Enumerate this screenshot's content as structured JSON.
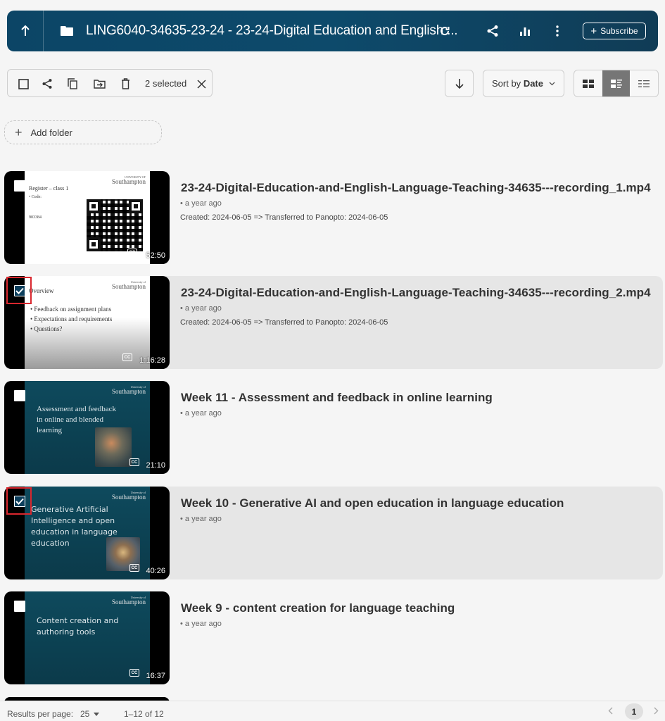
{
  "header": {
    "title": "LING6040-34635-23-24 - 23-24-Digital Education and English ...",
    "subscribe_label": "Subscribe"
  },
  "toolbar": {
    "selected_count": "2 selected",
    "sort_prefix": "Sort by",
    "sort_value": "Date"
  },
  "add_folder_label": "Add folder",
  "sessions": [
    {
      "title": "23-24-Digital-Education-and-English-Language-Teaching-34635---recording_1.mp4",
      "age": "a year ago",
      "created": "Created: 2024-06-05 => Transferred to Panopto: 2024-06-05",
      "duration": "52:50",
      "selected": false,
      "slide": {
        "heading": "Register – class 1",
        "line1": "• Code:",
        "line2": "903384",
        "logo_small": "UNIVERSITY OF",
        "logo": "Southampton"
      }
    },
    {
      "title": "23-24-Digital-Education-and-English-Language-Teaching-34635---recording_2.mp4",
      "age": "a year ago",
      "created": "Created: 2024-06-05 => Transferred to Panopto: 2024-06-05",
      "duration": "1:16:28",
      "selected": true,
      "slide": {
        "heading": "Overview",
        "b1": "• Feedback on assignment plans",
        "b2": "• Expectations and requirements",
        "b3": "• Questions?",
        "logo_small": "University of",
        "logo": "Southampton"
      }
    },
    {
      "title": "Week 11 - Assessment and feedback in online learning",
      "age": "a year ago",
      "duration": "21:10",
      "selected": false,
      "slide": {
        "l1": "Assessment and feedback",
        "l2": "in online and blended",
        "l3": "learning",
        "logo_small": "University of",
        "logo": "Southampton"
      }
    },
    {
      "title": "Week 10 - Generative AI and open education in language education",
      "age": "a year ago",
      "duration": "40:26",
      "selected": true,
      "slide": {
        "l1": "Generative Artificial",
        "l2": "Intelligence and open",
        "l3": "education in language",
        "l4": "education",
        "logo_small": "University of",
        "logo": "Southampton"
      }
    },
    {
      "title": "Week 9 - content creation for language teaching",
      "age": "a year ago",
      "duration": "16:37",
      "selected": false,
      "slide": {
        "l1": "Content creation and",
        "l2": "authoring tools",
        "logo_small": "University of",
        "logo": "Southampton"
      }
    }
  ],
  "footer": {
    "results_label": "Results per page:",
    "per_page": "25",
    "range": "1–12 of 12",
    "page": "1"
  },
  "colors": {
    "header_bg": "#0d4a6b",
    "selected_row_bg": "#e6e6e6",
    "checkbox_checked": "#0d3f5c",
    "highlight_red": "#d9272e",
    "view_active": "#767676"
  }
}
